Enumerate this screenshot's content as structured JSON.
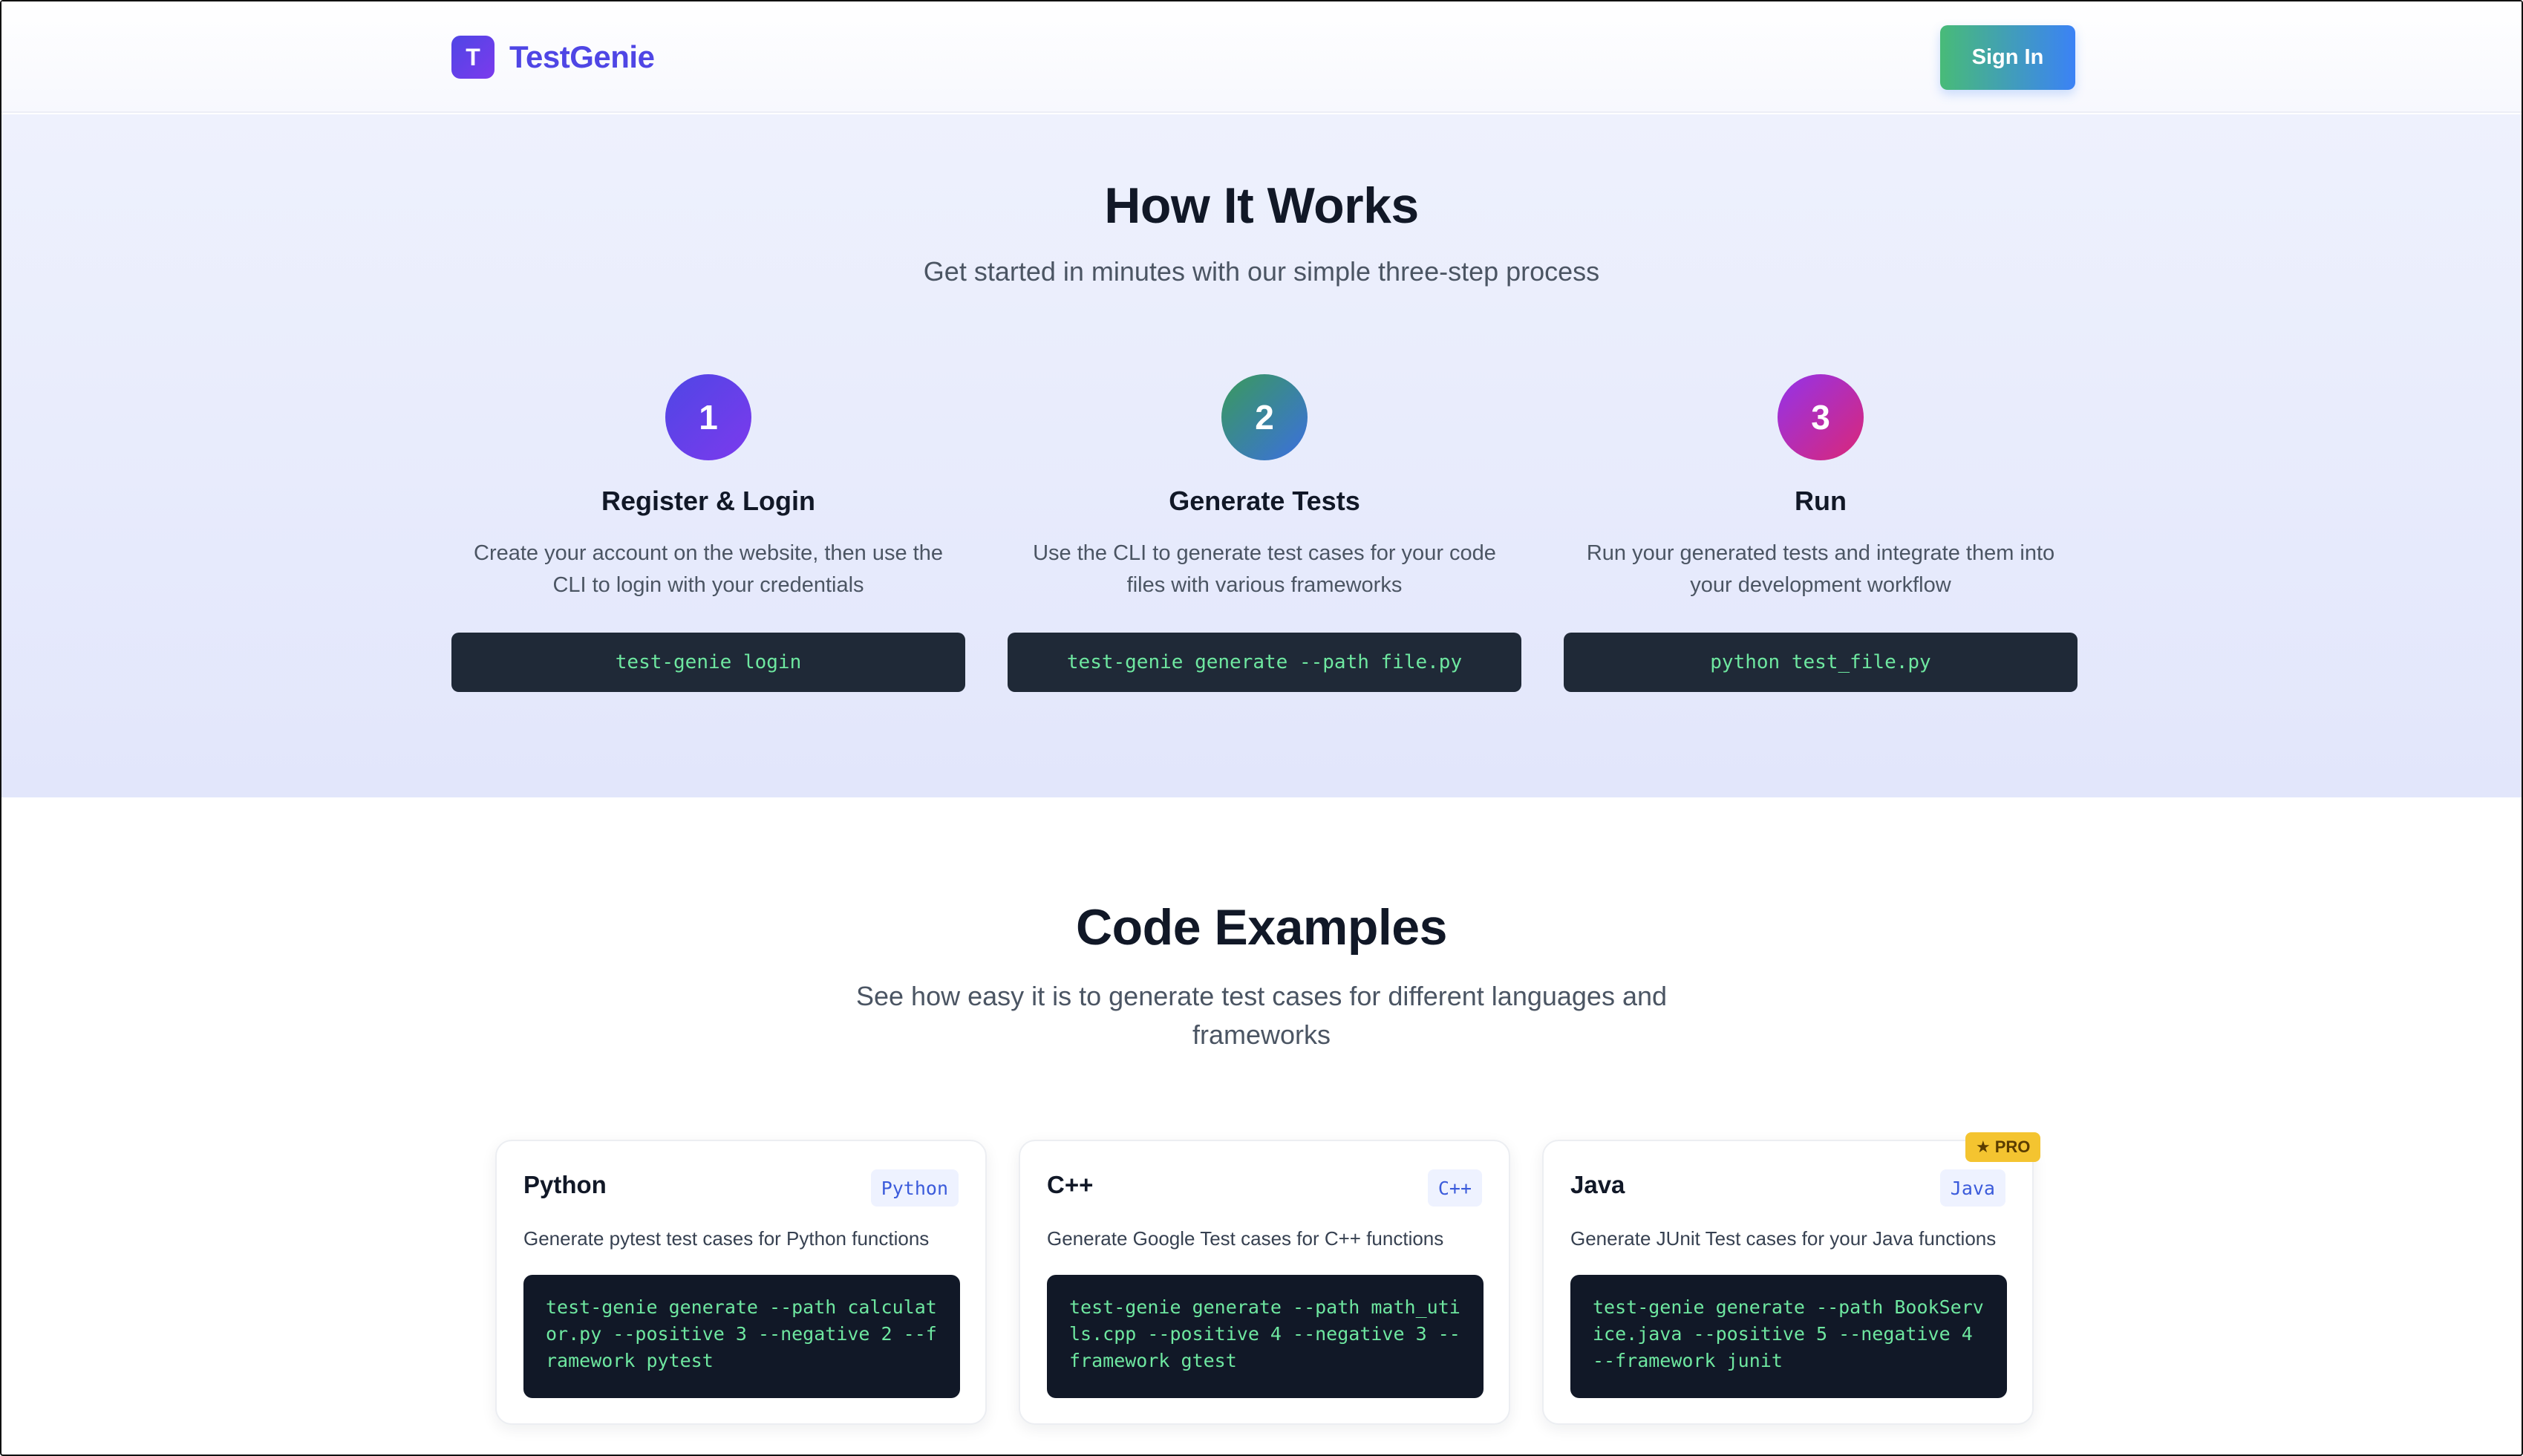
{
  "brand": {
    "logo_letter": "T",
    "name": "TestGenie"
  },
  "header": {
    "signin_label": "Sign In"
  },
  "how_it_works": {
    "title": "How It Works",
    "subtitle": "Get started in minutes with our simple three-step process",
    "steps": [
      {
        "number": "1",
        "title": "Register & Login",
        "description": "Create your account on the website, then use the CLI to login with your credentials",
        "command": "test-genie login",
        "color_from": "#4f46e5",
        "color_to": "#7c3aed"
      },
      {
        "number": "2",
        "title": "Generate Tests",
        "description": "Use the CLI to generate test cases for your code files with various frameworks",
        "command": "test-genie generate --path file.py",
        "color_from": "#3a9a5b",
        "color_to": "#3b6fe0"
      },
      {
        "number": "3",
        "title": "Run",
        "description": "Run your generated tests and integrate them into your development workflow",
        "command": "python test_file.py",
        "color_from": "#9333ea",
        "color_to": "#db2777"
      }
    ]
  },
  "code_examples": {
    "title": "Code Examples",
    "subtitle": "See how easy it is to generate test cases for different languages and frameworks",
    "pro_badge": {
      "icon": "star-icon",
      "label": "PRO"
    },
    "cards": [
      {
        "title": "Python",
        "badge": "Python",
        "description": "Generate pytest test cases for Python functions",
        "code": "test-genie generate --path calculator.py --positive 3 --negative 2 --framework pytest"
      },
      {
        "title": "C++",
        "badge": "C++",
        "description": "Generate Google Test cases for C++ functions",
        "code": "test-genie generate --path math_utils.cpp --positive 4 --negative 3 --framework gtest"
      },
      {
        "title": "Java",
        "badge": "Java",
        "description": "Generate JUnit Test cases for your Java functions",
        "code": "test-genie generate --path BookService.java --positive 5 --negative 4 --framework junit"
      }
    ]
  }
}
